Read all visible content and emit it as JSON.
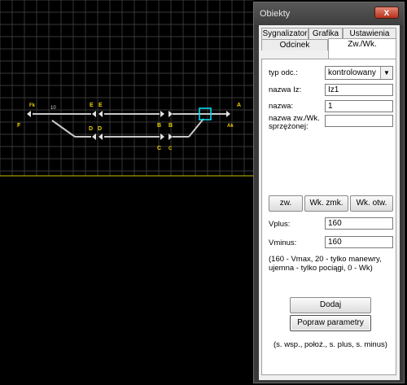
{
  "canvas": {
    "labels": {
      "fk": "Fk",
      "f": "F",
      "ten": "10",
      "e1": "E",
      "e2": "E",
      "d1": "D",
      "d2": "D",
      "b1": "B",
      "b2": "B",
      "c1": "C",
      "c2": "C",
      "a": "A",
      "ak": "Ak"
    }
  },
  "window": {
    "title": "Obiekty",
    "close_label": "x",
    "tabs": [
      "Sygnalizator",
      "Grafika",
      "Ustawienia",
      "Odcinek",
      "Zw./Wk."
    ],
    "form": {
      "typ_label": "typ odc.:",
      "typ_value": "kontrolowany",
      "nazwa_iz_label": "nazwa Iz:",
      "nazwa_iz_value": "Iz1",
      "nazwa_label": "nazwa:",
      "nazwa_value": "1",
      "sprz_label_1": "nazwa zw./Wk.",
      "sprz_label_2": "sprzężonej:",
      "sprz_value": "",
      "btn_zw": "zw.",
      "btn_wk_zmk": "Wk. zmk.",
      "btn_wk_otw": "Wk. otw.",
      "vplus_label": "Vplus:",
      "vplus_value": "160",
      "vminus_label": "Vminus:",
      "vminus_value": "160",
      "note_1": "(160 - Vmax, 20 - tylko manewry,",
      "note_2": "ujemna - tylko pociągi, 0 - Wk)",
      "btn_dodaj": "Dodaj",
      "btn_popraw": "Popraw parametry",
      "footer": "(s. wsp., położ., s. plus, s. minus)"
    }
  },
  "colors": {
    "background": "#000000",
    "grid": "#4a4a4a",
    "boundary": "#c8c000",
    "track": "#c8c8c8",
    "label_yellow": "#f0d000",
    "selection_cyan": "#00e5ff"
  }
}
